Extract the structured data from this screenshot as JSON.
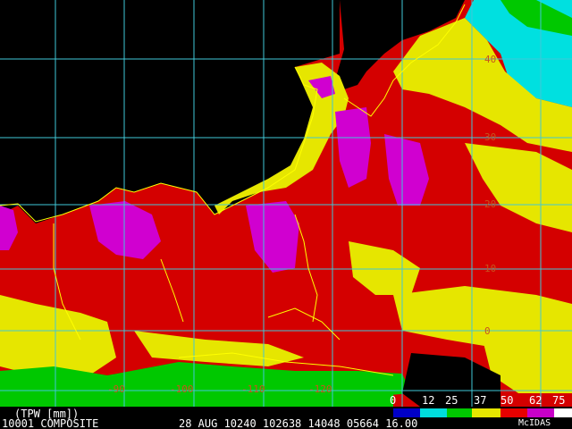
{
  "map": {
    "lat_labels": [
      "40",
      "30",
      "20",
      "10",
      "0"
    ],
    "lon_labels": [
      "-90",
      "-100",
      "-110",
      "-120"
    ]
  },
  "legend": {
    "title": "(TPW [mm])",
    "scale_values": [
      "0",
      "12",
      "25",
      "37",
      "50",
      "62",
      "75"
    ],
    "colors": {
      "0": "#0000c8",
      "12": "#00dcdc",
      "25": "#00c800",
      "37": "#e6e600",
      "50": "#e60000",
      "62": "#c800c8",
      "75": "#ffffff"
    }
  },
  "footer": {
    "product": "10001 COMPOSITE",
    "date": "28 AUG 10240 102638 14048 05664 16.00",
    "source": "McIDAS"
  }
}
